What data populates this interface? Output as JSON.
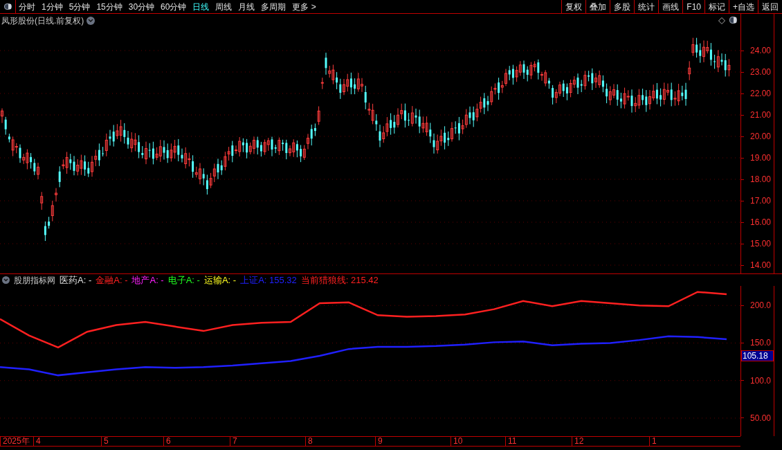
{
  "toolbar": {
    "periods": [
      {
        "label": "分时",
        "selected": false
      },
      {
        "label": "1分钟",
        "selected": false
      },
      {
        "label": "5分钟",
        "selected": false
      },
      {
        "label": "15分钟",
        "selected": false
      },
      {
        "label": "30分钟",
        "selected": false
      },
      {
        "label": "60分钟",
        "selected": false
      },
      {
        "label": "日线",
        "selected": true
      },
      {
        "label": "周线",
        "selected": false
      },
      {
        "label": "月线",
        "selected": false
      },
      {
        "label": "多周期",
        "selected": false
      },
      {
        "label": "更多 >",
        "selected": false
      }
    ],
    "actions": [
      "复权",
      "叠加",
      "多股",
      "统计",
      "画线",
      "F10",
      "标记",
      "+自选",
      "返回"
    ]
  },
  "price_chart": {
    "title": "凤形股份(日线.前复权)",
    "price_ticks": [
      "24.00",
      "23.00",
      "22.00",
      "21.00",
      "20.00",
      "19.00",
      "18.00",
      "17.00",
      "16.00",
      "15.00",
      "14.00"
    ]
  },
  "indicator": {
    "name": "股朋指标网",
    "legend": [
      {
        "text": "医药A: -",
        "color": "#e0e0e0"
      },
      {
        "text": "金融A: -",
        "color": "#ff2020"
      },
      {
        "text": "地产A: -",
        "color": "#ff20ff"
      },
      {
        "text": "电子A: -",
        "color": "#20ff20"
      },
      {
        "text": "运输A: -",
        "color": "#ffff20"
      },
      {
        "kind": "series",
        "text": "A: 155.32",
        "color": "#2020ff"
      },
      {
        "kind": "series",
        "text": ": 215.42",
        "color": "#ff2020"
      }
    ],
    "current_value": "105.18",
    "chart_data": {
      "type": "line",
      "categories": [
        null,
        null,
        null,
        null,
        null,
        null,
        null,
        null,
        null,
        null,
        null,
        null,
        null,
        null,
        null,
        null,
        null,
        null,
        null,
        null,
        null,
        null,
        null,
        null,
        null,
        null
      ],
      "ylim": [
        26,
        226
      ],
      "grid": true,
      "yticks": [
        {
          "value": 200,
          "label": "200.0"
        },
        {
          "value": 150,
          "label": "150.0"
        },
        {
          "value": 100,
          "label": "100.0"
        },
        {
          "value": 50,
          "label": "50.00"
        }
      ],
      "series": [
        {
          "name": "上证",
          "color": "#2020ff",
          "values": [
            118,
            115,
            107,
            111,
            115,
            118,
            117,
            118,
            120,
            123,
            126,
            133,
            142,
            145,
            145,
            146,
            148,
            151,
            152,
            147,
            149,
            150,
            154,
            159,
            158,
            155
          ]
        },
        {
          "name": "当前猎狼线",
          "color": "#ff2020",
          "values": [
            182,
            160,
            144,
            165,
            174,
            178,
            172,
            166,
            174,
            177,
            178,
            203,
            204,
            187,
            185,
            186,
            188,
            195,
            206,
            199,
            206,
            203,
            200,
            199,
            218,
            215
          ]
        }
      ]
    }
  },
  "date_axis": [
    "2025年",
    "4",
    "5",
    "6",
    "7",
    "8",
    "9",
    "10",
    "11",
    "12",
    "1"
  ]
}
